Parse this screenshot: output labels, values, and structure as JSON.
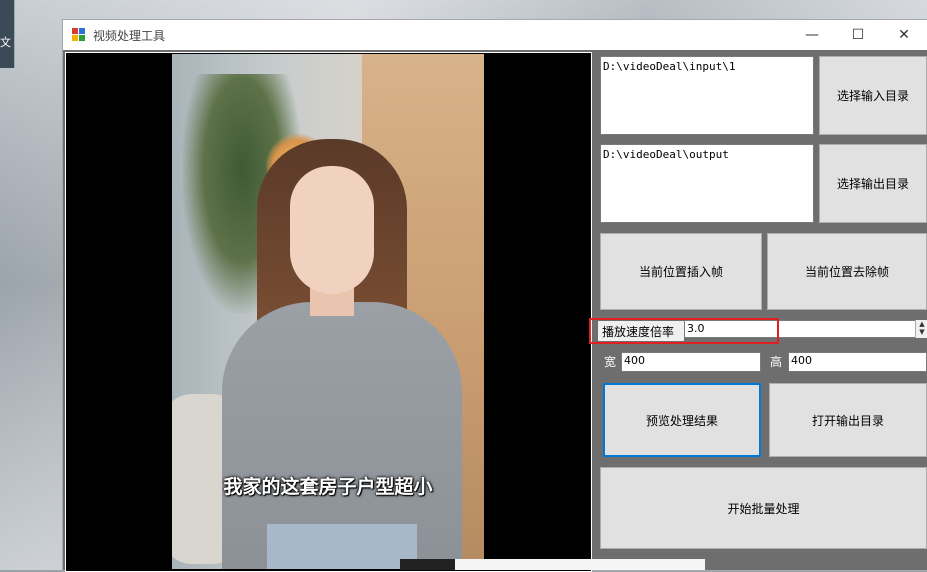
{
  "desktop": {
    "edge_text": "文"
  },
  "window": {
    "title": "视频处理工具",
    "controls": {
      "minimize": "—",
      "maximize": "☐",
      "close": "✕"
    }
  },
  "preview": {
    "subtitle": "我家的这套房子户型超小"
  },
  "paths": {
    "input_dir": "D:\\videoDeal\\input\\1",
    "output_dir": "D:\\videoDeal\\output"
  },
  "buttons": {
    "select_input": "选择输入目录",
    "select_output": "选择输出目录",
    "insert_frame": "当前位置插入帧",
    "remove_frame": "当前位置去除帧",
    "preview_result": "预览处理结果",
    "open_output": "打开输出目录",
    "start_batch": "开始批量处理"
  },
  "speed": {
    "label": "播放速度倍率",
    "value": "3.0"
  },
  "size": {
    "width_label": "宽",
    "width_value": "400",
    "height_label": "高",
    "height_value": "400"
  },
  "colors": {
    "focus": "#0078d7",
    "highlight": "#e02020"
  }
}
